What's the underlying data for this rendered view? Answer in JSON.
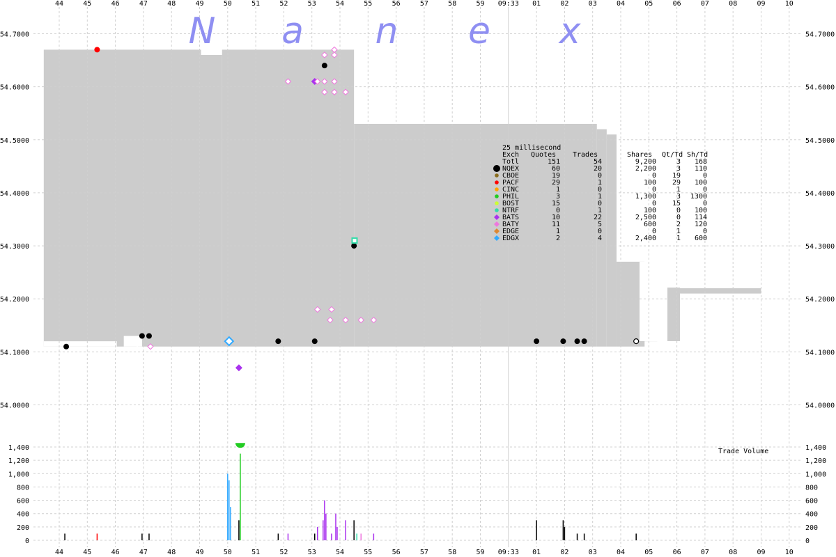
{
  "chart_data": [
    {
      "type": "scatter",
      "title": "Nanex",
      "watermark_letters": [
        "N",
        "a",
        "n",
        "e",
        "x"
      ],
      "x_ticks": [
        "44",
        "45",
        "46",
        "47",
        "48",
        "49",
        "50",
        "51",
        "52",
        "53",
        "54",
        "55",
        "56",
        "57",
        "58",
        "59",
        "09:33",
        "01",
        "02",
        "03",
        "04",
        "05",
        "06",
        "07",
        "08",
        "09",
        "10"
      ],
      "x_unit": "tick index (one tick ≈ 25 ms bucket label)",
      "xlim": [
        0,
        26
      ],
      "y_ticks": [
        "54.7000",
        "54.6000",
        "54.5000",
        "54.4000",
        "54.3000",
        "54.2000",
        "54.1000",
        "54.0000"
      ],
      "ylim": [
        53.98,
        54.72
      ],
      "grid": true,
      "nbbo_band": {
        "color": "#cccccc",
        "segments": [
          {
            "x0": -0.55,
            "x1": 5.05,
            "ask": 54.67,
            "bid": 54.11
          },
          {
            "x0": 5.05,
            "x1": 5.8,
            "ask": 54.66,
            "bid": 54.11
          },
          {
            "x0": 5.8,
            "x1": 10.5,
            "ask": 54.67,
            "bid": 54.11
          },
          {
            "x0": 10.5,
            "x1": 19.15,
            "ask": 54.53,
            "bid": 54.11
          },
          {
            "x0": 19.15,
            "x1": 19.5,
            "ask": 54.52,
            "bid": 54.11
          },
          {
            "x0": 19.5,
            "x1": 19.85,
            "ask": 54.51,
            "bid": 54.11
          },
          {
            "x0": 19.85,
            "x1": 20.85,
            "ask": 54.27,
            "bid": 54.11
          },
          {
            "x0": 20.85,
            "x1": 21.3,
            "ask": 54.22,
            "bid": 54.12
          },
          {
            "x0": 21.3,
            "x1": 25.0,
            "ask": 54.22,
            "bid": 54.21
          }
        ],
        "notches": [
          {
            "x0": -0.55,
            "x1": 2.05,
            "top": 54.12,
            "bottom": 54.11
          },
          {
            "x0": 2.3,
            "x1": 2.95,
            "top": 54.13,
            "bottom": 54.11
          },
          {
            "x0": 17.9,
            "x1": 19.15,
            "top": 54.11,
            "bottom": 54.11
          }
        ]
      },
      "trade_points": [
        {
          "x": 0.25,
          "y": 54.11,
          "exch": "NQEX"
        },
        {
          "x": 1.35,
          "y": 54.67,
          "exch": "PACF"
        },
        {
          "x": 2.95,
          "y": 54.13,
          "exch": "NQEX"
        },
        {
          "x": 3.2,
          "y": 54.13,
          "exch": "NQEX"
        },
        {
          "x": 7.8,
          "y": 54.12,
          "exch": "NQEX"
        },
        {
          "x": 9.1,
          "y": 54.12,
          "exch": "NQEX"
        },
        {
          "x": 9.45,
          "y": 54.64,
          "exch": "NQEX"
        },
        {
          "x": 10.5,
          "y": 54.3,
          "exch": "NQEX"
        },
        {
          "x": 17.0,
          "y": 54.12,
          "exch": "NQEX"
        },
        {
          "x": 17.95,
          "y": 54.12,
          "exch": "NQEX"
        },
        {
          "x": 18.45,
          "y": 54.12,
          "exch": "NQEX"
        },
        {
          "x": 18.7,
          "y": 54.12,
          "exch": "NQEX"
        },
        {
          "x": 6.4,
          "y": 54.07,
          "exch": "BATS"
        },
        {
          "x": 9.1,
          "y": 54.61,
          "exch": "BATS"
        },
        {
          "x": 10.52,
          "y": 54.31,
          "exch": "NTRF"
        }
      ],
      "quote_points": [
        {
          "x": 3.25,
          "y": 54.11,
          "exch": "BATY"
        },
        {
          "x": 6.05,
          "y": 54.12,
          "exch": "EDGX"
        },
        {
          "x": 8.15,
          "y": 54.61,
          "exch": "BATY"
        },
        {
          "x": 9.2,
          "y": 54.61,
          "exch": "BATY"
        },
        {
          "x": 9.45,
          "y": 54.66,
          "exch": "BATY"
        },
        {
          "x": 9.45,
          "y": 54.61,
          "exch": "BATY"
        },
        {
          "x": 9.45,
          "y": 54.59,
          "exch": "BATY"
        },
        {
          "x": 9.8,
          "y": 54.67,
          "exch": "BATY"
        },
        {
          "x": 9.8,
          "y": 54.66,
          "exch": "BATY"
        },
        {
          "x": 9.8,
          "y": 54.61,
          "exch": "BATY"
        },
        {
          "x": 9.8,
          "y": 54.59,
          "exch": "BATY"
        },
        {
          "x": 10.2,
          "y": 54.59,
          "exch": "BATY"
        },
        {
          "x": 9.2,
          "y": 54.18,
          "exch": "BATY"
        },
        {
          "x": 9.7,
          "y": 54.18,
          "exch": "BATY"
        },
        {
          "x": 9.65,
          "y": 54.16,
          "exch": "BATY"
        },
        {
          "x": 10.2,
          "y": 54.16,
          "exch": "BATY"
        },
        {
          "x": 10.75,
          "y": 54.16,
          "exch": "BATY"
        },
        {
          "x": 11.2,
          "y": 54.16,
          "exch": "BATY"
        },
        {
          "x": 20.55,
          "y": 54.12,
          "exch": "NQEX"
        }
      ],
      "stats_table": {
        "title": "25 millisecond",
        "headers": [
          "Exch",
          "Quotes",
          "Trades",
          "Shares",
          "Qt/Td",
          "Sh/Td"
        ],
        "rows": [
          {
            "exch": "Totl",
            "quotes": "151",
            "trades": "54",
            "shares": "9,200",
            "qttd": "3",
            "shtd": "168",
            "color": ""
          },
          {
            "exch": "NQEX",
            "quotes": "60",
            "trades": "20",
            "shares": "2,200",
            "qttd": "3",
            "shtd": "110",
            "color": "#000000"
          },
          {
            "exch": "CBOE",
            "quotes": "19",
            "trades": "0",
            "shares": "0",
            "qttd": "19",
            "shtd": "0",
            "color": "#8a6d1d"
          },
          {
            "exch": "PACF",
            "quotes": "29",
            "trades": "1",
            "shares": "100",
            "qttd": "29",
            "shtd": "100",
            "color": "#ff0000"
          },
          {
            "exch": "CINC",
            "quotes": "1",
            "trades": "0",
            "shares": "0",
            "qttd": "1",
            "shtd": "0",
            "color": "#ffa500"
          },
          {
            "exch": "PHIL",
            "quotes": "3",
            "trades": "1",
            "shares": "1,300",
            "qttd": "3",
            "shtd": "1300",
            "color": "#22cc22"
          },
          {
            "exch": "BOST",
            "quotes": "15",
            "trades": "0",
            "shares": "0",
            "qttd": "15",
            "shtd": "0",
            "color": "#ccff33"
          },
          {
            "exch": "NTRF",
            "quotes": "0",
            "trades": "1",
            "shares": "100",
            "qttd": "0",
            "shtd": "100",
            "color": "#33ddaa"
          },
          {
            "exch": "BATS",
            "quotes": "10",
            "trades": "22",
            "shares": "2,500",
            "qttd": "0",
            "shtd": "114",
            "color": "#aa33ee"
          },
          {
            "exch": "BATY",
            "quotes": "11",
            "trades": "5",
            "shares": "600",
            "qttd": "2",
            "shtd": "120",
            "color": "#ee77dd"
          },
          {
            "exch": "EDGE",
            "quotes": "1",
            "trades": "0",
            "shares": "0",
            "qttd": "1",
            "shtd": "0",
            "color": "#dd8833"
          },
          {
            "exch": "EDGX",
            "quotes": "2",
            "trades": "4",
            "shares": "2,400",
            "qttd": "1",
            "shtd": "600",
            "color": "#33aaff"
          }
        ]
      }
    },
    {
      "type": "bar",
      "title": "Trade Volume",
      "y_ticks": [
        "1,400",
        "1,200",
        "1,000",
        "800",
        "600",
        "400",
        "200",
        "0"
      ],
      "ylim": [
        0,
        1500
      ],
      "grid": true,
      "bars": [
        {
          "x": 0.2,
          "value": 100,
          "color": "#000000"
        },
        {
          "x": 1.35,
          "value": 100,
          "color": "#ff0000"
        },
        {
          "x": 2.95,
          "value": 100,
          "color": "#000000"
        },
        {
          "x": 3.2,
          "value": 100,
          "color": "#000000"
        },
        {
          "x": 6.0,
          "value": 1000,
          "color": "#33aaff"
        },
        {
          "x": 6.05,
          "value": 900,
          "color": "#33aaff"
        },
        {
          "x": 6.1,
          "value": 500,
          "color": "#33aaff"
        },
        {
          "x": 6.4,
          "value": 300,
          "color": "#000000"
        },
        {
          "x": 6.45,
          "value": 1300,
          "color": "#22cc22"
        },
        {
          "x": 7.8,
          "value": 100,
          "color": "#000000"
        },
        {
          "x": 8.15,
          "value": 100,
          "color": "#aa33ee"
        },
        {
          "x": 9.1,
          "value": 100,
          "color": "#000000"
        },
        {
          "x": 9.2,
          "value": 200,
          "color": "#aa33ee"
        },
        {
          "x": 9.4,
          "value": 300,
          "color": "#aa33ee"
        },
        {
          "x": 9.45,
          "value": 600,
          "color": "#aa33ee"
        },
        {
          "x": 9.5,
          "value": 400,
          "color": "#aa33ee"
        },
        {
          "x": 9.7,
          "value": 100,
          "color": "#aa33ee"
        },
        {
          "x": 9.85,
          "value": 400,
          "color": "#aa33ee"
        },
        {
          "x": 9.9,
          "value": 200,
          "color": "#aa33ee"
        },
        {
          "x": 10.2,
          "value": 300,
          "color": "#aa33ee"
        },
        {
          "x": 10.5,
          "value": 300,
          "color": "#000000"
        },
        {
          "x": 10.6,
          "value": 100,
          "color": "#33ddaa"
        },
        {
          "x": 10.75,
          "value": 100,
          "color": "#ee77dd"
        },
        {
          "x": 11.2,
          "value": 100,
          "color": "#aa33ee"
        },
        {
          "x": 17.0,
          "value": 300,
          "color": "#000000"
        },
        {
          "x": 17.95,
          "value": 300,
          "color": "#000000"
        },
        {
          "x": 18.0,
          "value": 200,
          "color": "#000000"
        },
        {
          "x": 18.45,
          "value": 100,
          "color": "#000000"
        },
        {
          "x": 18.7,
          "value": 100,
          "color": "#000000"
        },
        {
          "x": 20.55,
          "value": 100,
          "color": "#000000"
        }
      ],
      "peak_marker": {
        "x": 6.45,
        "value": 1460,
        "color": "#22cc22"
      }
    }
  ]
}
